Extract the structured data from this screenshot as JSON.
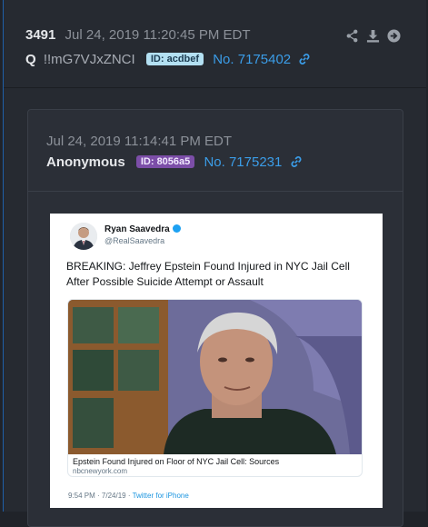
{
  "outer_post": {
    "number": "3491",
    "date": "Jul 24, 2019 11:20:45 PM EDT",
    "name": "Q",
    "tripcode": "!!mG7VJxZNCI",
    "id_badge": "ID: acdbef",
    "post_link": "No. 7175402"
  },
  "inner_post": {
    "date": "Jul 24, 2019 11:14:41 PM EDT",
    "name": "Anonymous",
    "id_badge": "ID: 8056a5",
    "post_link": "No. 7175231"
  },
  "tweet": {
    "author_name": "Ryan Saavedra",
    "handle": "@RealSaavedra",
    "text": "BREAKING: Jeffrey Epstein Found Injured in NYC Jail Cell After Possible Suicide Attempt or Assault",
    "card_title": "Epstein Found Injured on Floor of NYC Jail Cell: Sources",
    "card_domain": "nbcnewyork.com",
    "timestamp": "9:54 PM · 7/24/19 · ",
    "source": "Twitter for iPhone"
  },
  "icons": {
    "share": "share-icon",
    "download": "download-icon",
    "goto": "arrow-right-circle-icon",
    "link": "link-icon"
  },
  "colors": {
    "accent_link": "#3b9de8",
    "id_acdbef_bg": "#b3e0f2",
    "id_8056a5_bg": "#7c4ea8"
  }
}
